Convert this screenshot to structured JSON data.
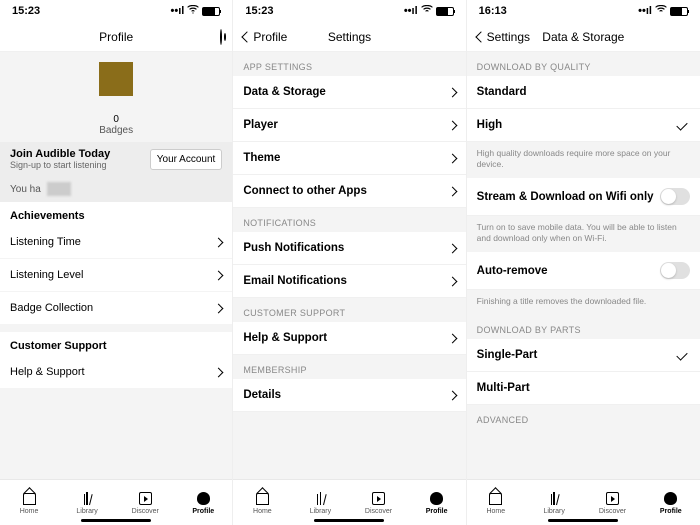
{
  "screen1": {
    "time": "15:23",
    "title": "Profile",
    "badges_count": "0",
    "badges_label": "Badges",
    "join_title": "Join Audible Today",
    "join_sub": "Sign-up to start listening",
    "account_btn": "Your Account",
    "you_have": "You ha",
    "achievements_h": "Achievements",
    "rows_ach": [
      "Listening Time",
      "Listening Level",
      "Badge Collection"
    ],
    "support_h": "Customer Support",
    "rows_sup": [
      "Help & Support"
    ]
  },
  "screen2": {
    "time": "15:23",
    "back": "Profile",
    "title": "Settings",
    "groups": [
      {
        "header": "APP SETTINGS",
        "rows": [
          "Data & Storage",
          "Player",
          "Theme",
          "Connect to other Apps"
        ]
      },
      {
        "header": "NOTIFICATIONS",
        "rows": [
          "Push Notifications",
          "Email Notifications"
        ]
      },
      {
        "header": "CUSTOMER SUPPORT",
        "rows": [
          "Help & Support"
        ]
      },
      {
        "header": "MEMBERSHIP",
        "rows": [
          "Details"
        ]
      }
    ]
  },
  "screen3": {
    "time": "16:13",
    "back": "Settings",
    "title": "Data & Storage",
    "quality_h": "DOWNLOAD BY QUALITY",
    "quality_opts": [
      {
        "label": "Standard",
        "selected": false
      },
      {
        "label": "High",
        "selected": true
      }
    ],
    "quality_foot": "High quality downloads require more space on your device.",
    "wifi_label": "Stream & Download on Wifi only",
    "wifi_foot": "Turn on to save mobile data. You will be able to listen and download only when on Wi-Fi.",
    "auto_label": "Auto-remove",
    "auto_foot": "Finishing a title removes the downloaded file.",
    "parts_h": "DOWNLOAD BY PARTS",
    "parts_opts": [
      {
        "label": "Single-Part",
        "selected": true
      },
      {
        "label": "Multi-Part",
        "selected": false
      }
    ],
    "advanced_h": "ADVANCED"
  },
  "tabs": [
    {
      "label": "Home",
      "icon": "home"
    },
    {
      "label": "Library",
      "icon": "library"
    },
    {
      "label": "Discover",
      "icon": "discover"
    },
    {
      "label": "Profile",
      "icon": "profile",
      "active": true
    }
  ]
}
